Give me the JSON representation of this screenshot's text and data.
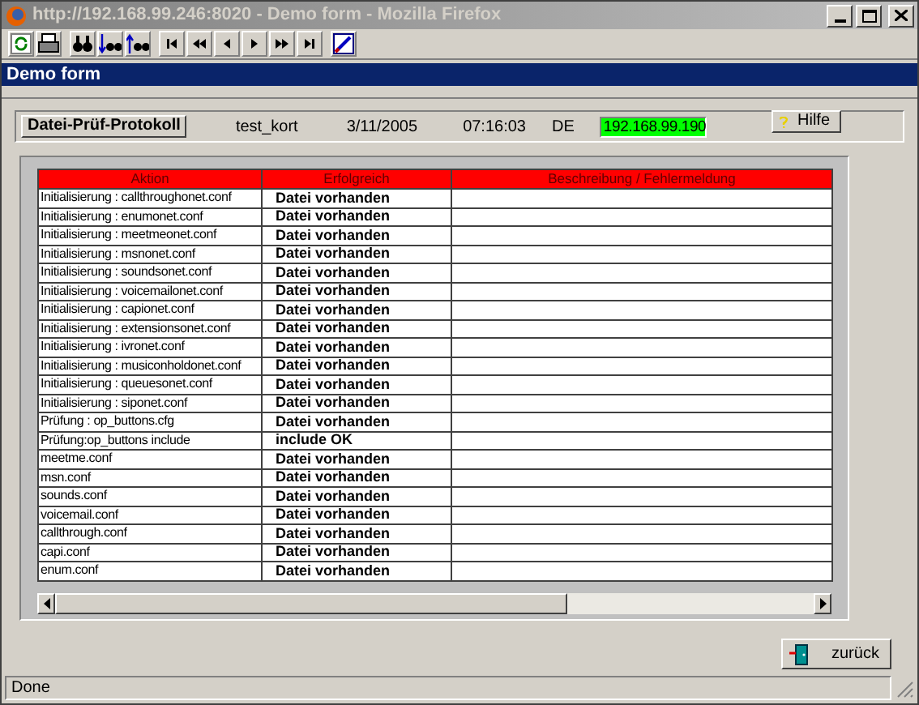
{
  "window": {
    "title": "http://192.168.99.246:8020 - Demo form - Mozilla Firefox"
  },
  "form_title": "Demo form",
  "header": {
    "protocol_button": "Datei-Prüf-Protokoll",
    "user": "test_kort",
    "date": "3/11/2005",
    "time": "07:16:03",
    "language": "DE",
    "ip": "192.168.99.190",
    "help_button": "Hilfe"
  },
  "table": {
    "columns": [
      "Aktion",
      "Erfolgreich",
      "Beschreibung / Fehlermeldung"
    ],
    "rows": [
      {
        "aktion": "Initialisierung : callthroughonet.conf",
        "erfolgreich": "Datei vorhanden"
      },
      {
        "aktion": "Initialisierung : enumonet.conf",
        "erfolgreich": "Datei vorhanden"
      },
      {
        "aktion": "Initialisierung : meetmeonet.conf",
        "erfolgreich": "Datei vorhanden"
      },
      {
        "aktion": "Initialisierung : msnonet.conf",
        "erfolgreich": "Datei vorhanden"
      },
      {
        "aktion": "Initialisierung : soundsonet.conf",
        "erfolgreich": "Datei vorhanden"
      },
      {
        "aktion": "Initialisierung : voicemailonet.conf",
        "erfolgreich": "Datei vorhanden"
      },
      {
        "aktion": "Initialisierung : capionet.conf",
        "erfolgreich": "Datei vorhanden"
      },
      {
        "aktion": "Initialisierung : extensionsonet.conf",
        "erfolgreich": "Datei vorhanden"
      },
      {
        "aktion": "Initialisierung : ivronet.conf",
        "erfolgreich": "Datei vorhanden"
      },
      {
        "aktion": "Initialisierung : musiconholdonet.conf",
        "erfolgreich": "Datei vorhanden"
      },
      {
        "aktion": "Initialisierung : queuesonet.conf",
        "erfolgreich": "Datei vorhanden"
      },
      {
        "aktion": "Initialisierung : siponet.conf",
        "erfolgreich": "Datei vorhanden"
      },
      {
        "aktion": "Prüfung : op_buttons.cfg",
        "erfolgreich": "Datei vorhanden"
      },
      {
        "aktion": "Prüfung:op_buttons include",
        "erfolgreich": "include OK"
      },
      {
        "aktion": "meetme.conf",
        "erfolgreich": "Datei vorhanden"
      },
      {
        "aktion": "msn.conf",
        "erfolgreich": "Datei vorhanden"
      },
      {
        "aktion": "sounds.conf",
        "erfolgreich": "Datei vorhanden"
      },
      {
        "aktion": "voicemail.conf",
        "erfolgreich": "Datei vorhanden"
      },
      {
        "aktion": "callthrough.conf",
        "erfolgreich": "Datei vorhanden"
      },
      {
        "aktion": "capi.conf",
        "erfolgreich": "Datei vorhanden"
      },
      {
        "aktion": "enum.conf",
        "erfolgreich": "Datei vorhanden"
      }
    ]
  },
  "back_button": "zurück",
  "status_bar": "Done"
}
